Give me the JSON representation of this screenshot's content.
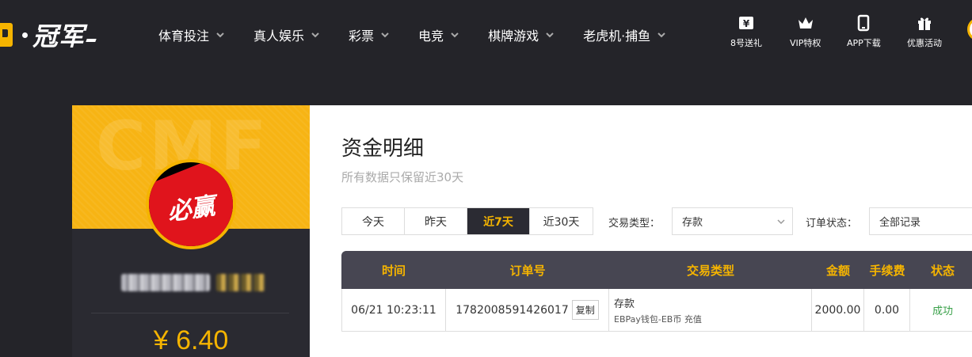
{
  "brand": {
    "name": "冠军"
  },
  "nav": [
    {
      "label": "体育投注"
    },
    {
      "label": "真人娱乐"
    },
    {
      "label": "彩票"
    },
    {
      "label": "电竞"
    },
    {
      "label": "棋牌游戏"
    },
    {
      "label": "老虎机·捕鱼"
    }
  ],
  "quick_links": [
    {
      "label": "8号送礼",
      "icon": "gift-ticket-icon"
    },
    {
      "label": "VIP特权",
      "icon": "crown-icon"
    },
    {
      "label": "APP下载",
      "icon": "phone-icon"
    },
    {
      "label": "优惠活动",
      "icon": "gift-box-icon"
    }
  ],
  "profile": {
    "watermark": "CMF",
    "avatar_text": "必赢",
    "balance": "¥ 6.40"
  },
  "main": {
    "title": "资金明细",
    "subtitle": "所有数据只保留近30天",
    "ranges": [
      "今天",
      "昨天",
      "近7天",
      "近30天"
    ],
    "active_range": "近7天",
    "filter_type_label": "交易类型：",
    "filter_type_value": "存款",
    "filter_status_label": "订单状态：",
    "filter_status_value": "全部记录"
  },
  "table": {
    "headers": [
      "时间",
      "订单号",
      "交易类型",
      "金额",
      "手续费",
      "状态"
    ],
    "rows": [
      {
        "time": "06/21 10:23:11",
        "order_no": "1782008591426017",
        "copy_label": "复制",
        "type_main": "存款",
        "type_sub": "EBPay钱包-EB币 充值",
        "amount": "2000.00",
        "fee": "0.00",
        "status": "成功"
      }
    ]
  },
  "colors": {
    "accent": "#f5b400",
    "background": "#242429",
    "table_header": "#474652",
    "success": "#3aa14a"
  }
}
